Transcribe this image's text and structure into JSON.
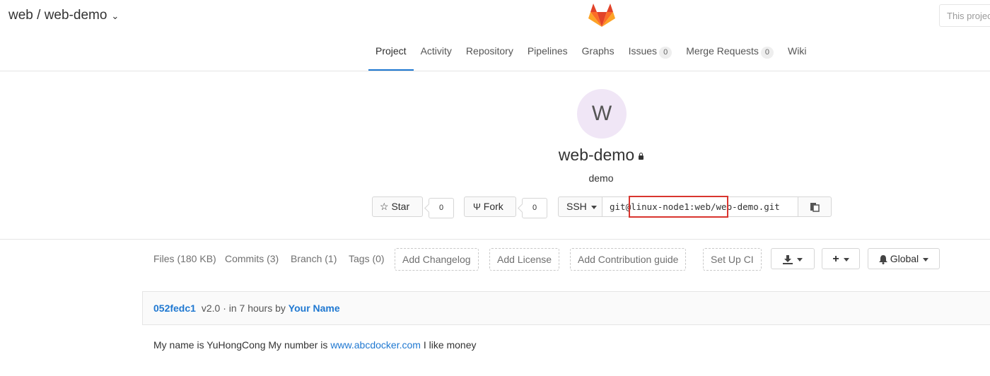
{
  "header": {
    "breadcrumb": "web / web-demo",
    "search_placeholder": "This project"
  },
  "nav": {
    "tabs": [
      {
        "label": "Project"
      },
      {
        "label": "Activity"
      },
      {
        "label": "Repository"
      },
      {
        "label": "Pipelines"
      },
      {
        "label": "Graphs"
      },
      {
        "label": "Issues",
        "badge": "0"
      },
      {
        "label": "Merge Requests",
        "badge": "0"
      },
      {
        "label": "Wiki"
      }
    ]
  },
  "project": {
    "avatar_letter": "W",
    "name": "web-demo",
    "description": "demo",
    "star_label": "Star",
    "star_count": "0",
    "fork_label": "Fork",
    "fork_count": "0",
    "protocol": "SSH",
    "clone_url": "git@linux-node1:web/web-demo.git"
  },
  "repo": {
    "stats": [
      {
        "label": "Files (180 KB)"
      },
      {
        "label": "Commits (3)"
      },
      {
        "label": "Branch (1)"
      },
      {
        "label": "Tags (0)"
      }
    ],
    "add_changelog": "Add Changelog",
    "add_license": "Add License",
    "add_contribution": "Add Contribution guide",
    "setup_ci": "Set Up CI",
    "notification": "Global"
  },
  "commit": {
    "sha": "052fedc1",
    "message": "v2.0",
    "time": "· in 7 hours by",
    "author": "Your Name"
  },
  "readme": {
    "text_before": "My name is YuHongCong My number is",
    "link": "www.abcdocker.com",
    "text_after": "I like money"
  },
  "colors": {
    "accent": "#1f78d1",
    "highlight": "#d9352f",
    "logo_orange": "#fc6d26"
  }
}
